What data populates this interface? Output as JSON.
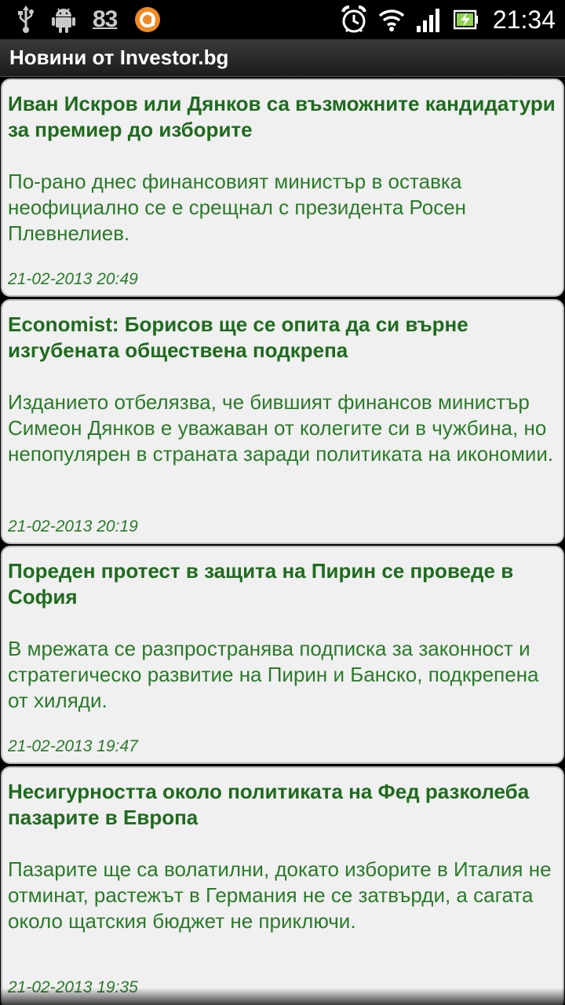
{
  "status_bar": {
    "notification_count": "83",
    "time": "21:34"
  },
  "app": {
    "title": "Новини от Investor.bg"
  },
  "news": [
    {
      "title": "Иван Искров или Дянков са възможните кандидатури за премиер до изборите",
      "summary": "По-рано днес финансовият министър в оставка неофициално се е срещнал с президента Росен Плевнелиев.",
      "date": "21-02-2013 20:49"
    },
    {
      "title": "Economist: Борисов ще се опита да си върне изгубената обществена подкрепа",
      "summary": "Изданието отбелязва, че бившият финансов министър Симеон Дянков е уважаван от колегите си в чужбина, но непопулярен в страната заради политиката на икономии.",
      "date": "21-02-2013 20:19"
    },
    {
      "title": "Пореден протест в защита на Пирин се проведе в София",
      "summary": "В мрежата се разпространява подписка за законност и стратегическо развитие на Пирин и Банско, подкрепена от хиляди.",
      "date": "21-02-2013 19:47"
    },
    {
      "title": "Несигурността около политиката на Фед разколеба пазарите в Европа",
      "summary": "Пазарите ще са волатилни, докато изборите в Италия не отминат, растежът в Германия не се затвърди, а сагата около щатския бюджет не приключи.",
      "date": "21-02-2013 19:35"
    }
  ],
  "colors": {
    "headline": "#1f6b1f",
    "text": "#2a7a2a",
    "card_bg": "#f0f0f0"
  }
}
